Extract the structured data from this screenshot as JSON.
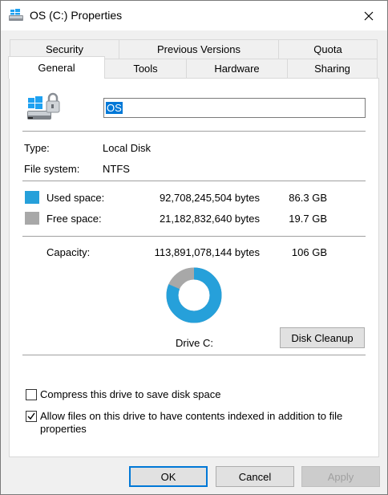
{
  "window": {
    "title": "OS (C:) Properties"
  },
  "tabs_back": [
    {
      "label": "Security"
    },
    {
      "label": "Previous Versions"
    },
    {
      "label": "Quota"
    }
  ],
  "tabs_front": [
    {
      "label": "General"
    },
    {
      "label": "Tools"
    },
    {
      "label": "Hardware"
    },
    {
      "label": "Sharing"
    }
  ],
  "general": {
    "drive_name_value": "OS",
    "type_label": "Type:",
    "type_value": "Local Disk",
    "fs_label": "File system:",
    "fs_value": "NTFS",
    "used_label": "Used space:",
    "used_bytes": "92,708,245,504 bytes",
    "used_gb": "86.3 GB",
    "free_label": "Free space:",
    "free_bytes": "21,182,832,640 bytes",
    "free_gb": "19.7 GB",
    "capacity_label": "Capacity:",
    "capacity_bytes": "113,891,078,144 bytes",
    "capacity_gb": "106 GB",
    "drive_label": "Drive C:",
    "cleanup_label": "Disk Cleanup",
    "compress_label": "Compress this drive to save disk space",
    "compress_checked": false,
    "index_label_line1": "Allow files on this drive to have contents indexed in addition to file",
    "index_label_line2": "properties",
    "index_checked": true
  },
  "colors": {
    "used": "#26a0da",
    "free": "#a8a8a8"
  },
  "chart_data": {
    "type": "pie",
    "labels": [
      "Used space",
      "Free space"
    ],
    "values": [
      86.3,
      19.7
    ]
  },
  "buttons": {
    "ok": "OK",
    "cancel": "Cancel",
    "apply": "Apply"
  }
}
